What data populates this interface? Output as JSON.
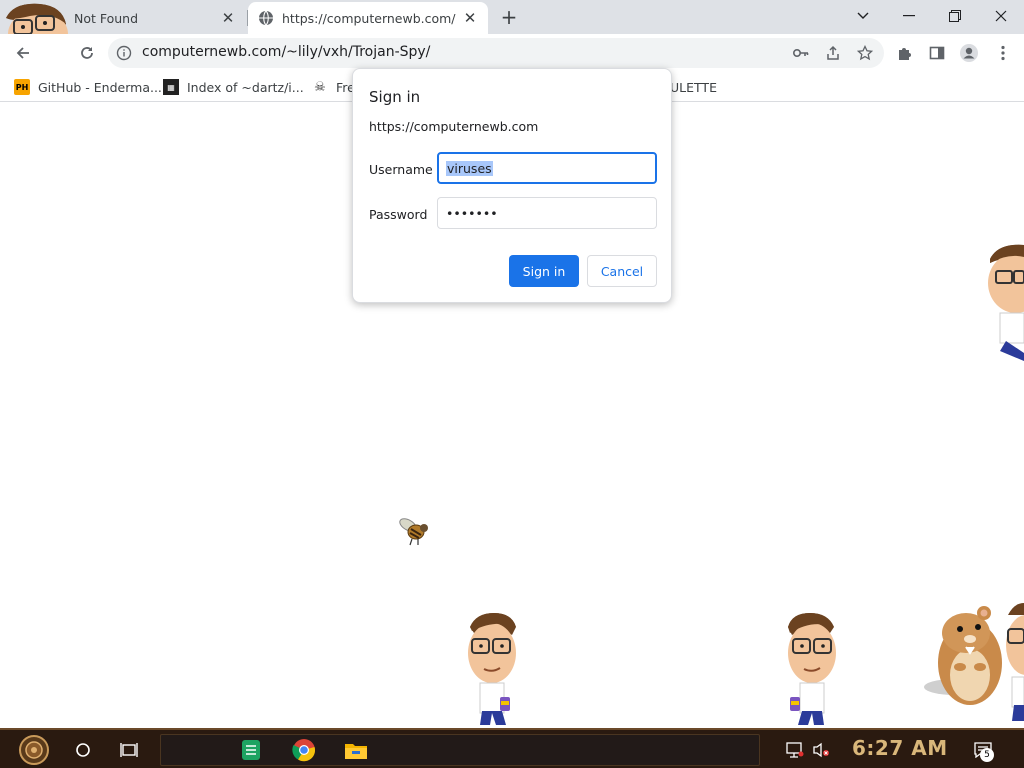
{
  "browser": {
    "tabs": [
      {
        "title": "Not Found",
        "active": false
      },
      {
        "title": "https://computernewb.com/~lily/vxh/Trojan-Spy/",
        "active": true
      }
    ],
    "address_bar": {
      "url": "computernewb.com/~lily/vxh/Trojan-Spy/"
    },
    "bookmarks": [
      {
        "label": "GitHub - Enderma...",
        "icon": "ph-icon"
      },
      {
        "label": "Index of ~dartz/i...",
        "icon": "index-icon"
      },
      {
        "label": "Fre",
        "icon": "skull-icon"
      },
      {
        "label": "ULETTE",
        "icon": ""
      }
    ]
  },
  "dialog": {
    "title": "Sign in",
    "origin": "https://computernewb.com",
    "username_label": "Username",
    "username_value": "viruses",
    "password_label": "Password",
    "password_value": "•••••••",
    "sign_in_label": "Sign in",
    "cancel_label": "Cancel"
  },
  "taskbar": {
    "clock": "6:27 AM",
    "notification_count": "5"
  },
  "colors": {
    "accent": "#1a73e8",
    "tabstrip": "#dee1e6",
    "taskbar": "#2a1a10",
    "clock": "#d9b77a"
  }
}
